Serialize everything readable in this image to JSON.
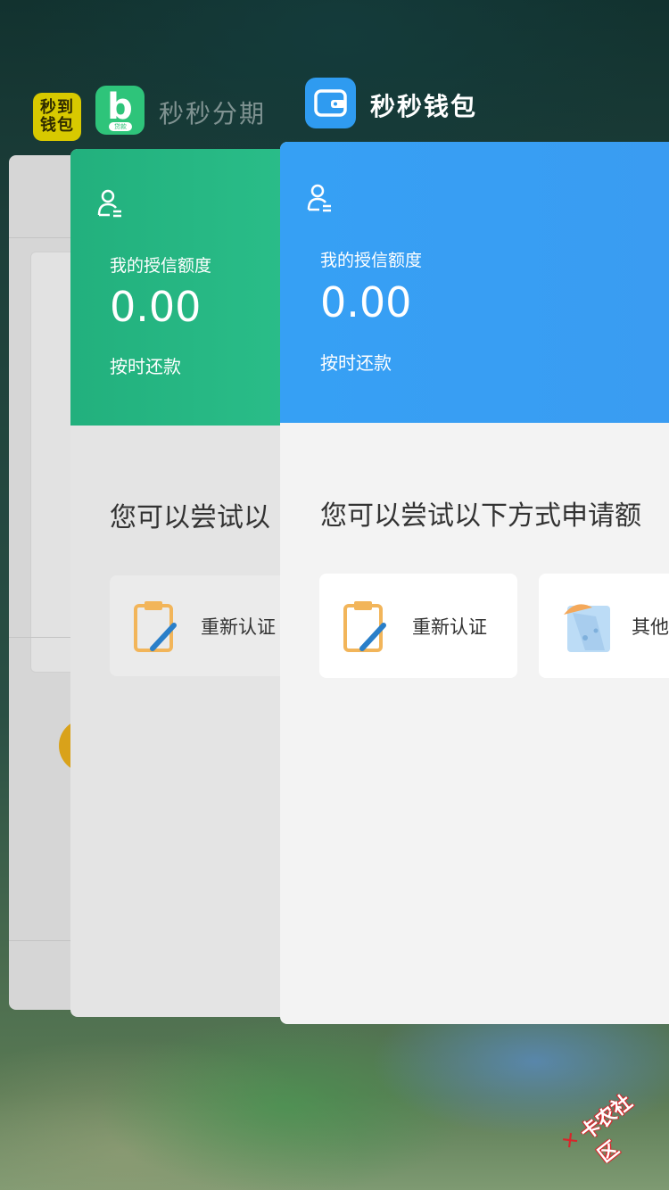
{
  "app_switcher": {
    "apps": [
      {
        "icon_name": "miaodao-qianbao-app-icon",
        "icon_text": "秒到钱包",
        "color": "#d8c900"
      },
      {
        "icon_name": "miaomiao-fenqi-app-icon",
        "icon_text": "b",
        "icon_tag": "贷款",
        "label": "秒秒分期",
        "color": "#2ec47a"
      },
      {
        "icon_name": "miaomiao-qianbao-app-icon",
        "label": "秒秒钱包",
        "color": "#2f9bf0"
      }
    ]
  },
  "card_fenqi": {
    "credit_label": "我的授信额度",
    "credit_value": "0.00",
    "repay_label": "按时还款",
    "try_text": "您可以尝试以",
    "options": [
      {
        "label": "重新认证",
        "icon": "clipboard-pen-icon"
      }
    ],
    "header_color": "#22b07d"
  },
  "card_qianbao": {
    "credit_label": "我的授信额度",
    "credit_value": "0.00",
    "repay_label": "按时还款",
    "try_text": "您可以尝试以下方式申请额",
    "options": [
      {
        "label": "重新认证",
        "icon": "clipboard-pen-icon"
      },
      {
        "label": "其他",
        "icon": "ufo-icon"
      }
    ],
    "header_color": "#36a0f4"
  },
  "watermark": {
    "text": "卡农社区",
    "icon": "k-logo-icon"
  }
}
